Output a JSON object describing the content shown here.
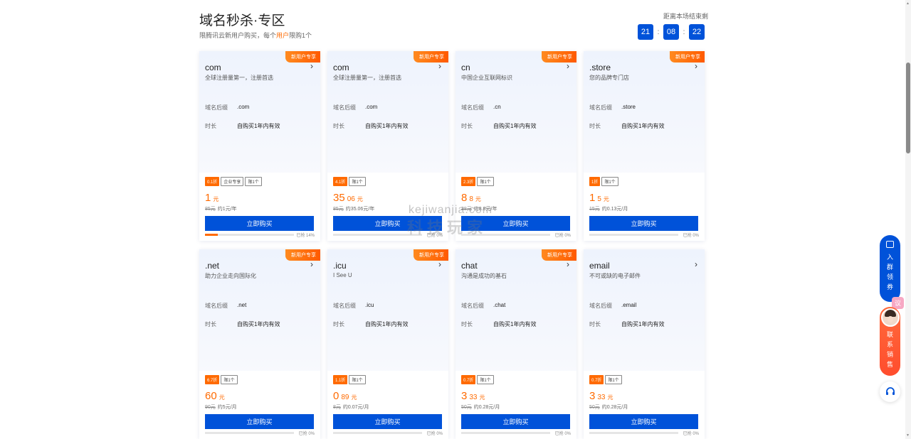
{
  "header": {
    "title": "域名秒杀·专区",
    "subtitle_prefix": "限腾讯云新用户购买，每个",
    "subtitle_highlight": "用户",
    "subtitle_suffix": "限购1个"
  },
  "countdown": {
    "label": "距离本场结束剩",
    "hours": "21",
    "minutes": "08",
    "seconds": "22",
    "sep": ":"
  },
  "labels": {
    "suffix_key": "域名后缀",
    "duration_key": "时长",
    "buy": "立即购买",
    "unit": "元",
    "limit": "限1个",
    "enterprise": "企业专享"
  },
  "cards": [
    {
      "badge": "新用户专享",
      "name": "com",
      "desc": "全球注册量第一，注册首选",
      "suffix": ".com",
      "duration": "自购买1年内有效",
      "discount": "0.1折",
      "enterprise": true,
      "price_int": "1",
      "price_dec": "",
      "orig": "85元",
      "per": "约1元/年",
      "sold": "已抢 14%",
      "sold_pct": 14
    },
    {
      "badge": "新用户专享",
      "name": "com",
      "desc": "全球注册量第一，注册首选",
      "suffix": ".com",
      "duration": "自购买1年内有效",
      "discount": "4.1折",
      "enterprise": false,
      "price_int": "35",
      "price_dec": "06",
      "orig": "85元",
      "per": "约35.06元/年",
      "sold": "已抢 0%",
      "sold_pct": 0
    },
    {
      "badge": "新用户专享",
      "name": "cn",
      "desc": "中国企业互联网标识",
      "suffix": ".cn",
      "duration": "自购买1年内有效",
      "discount": "2.3折",
      "enterprise": false,
      "price_int": "8",
      "price_dec": "8",
      "orig": "38元",
      "per": "约8.8元/年",
      "sold": "已抢 0%",
      "sold_pct": 0
    },
    {
      "badge": "新用户专享",
      "name": ".store",
      "desc": "您的品牌专门店",
      "suffix": ".store",
      "duration": "自购买1年内有效",
      "discount": "1折",
      "enterprise": false,
      "price_int": "1",
      "price_dec": "5",
      "orig": "15元",
      "per": "约0.13元/月",
      "sold": "已抢 0%",
      "sold_pct": 0
    },
    {
      "badge": "新用户专享",
      "name": ".net",
      "desc": "助力企业走向国际化",
      "suffix": ".net",
      "duration": "自购买1年内有效",
      "discount": "6.7折",
      "enterprise": false,
      "price_int": "60",
      "price_dec": "",
      "orig": "90元",
      "per": "约5元/月",
      "sold": "已抢 0%",
      "sold_pct": 0
    },
    {
      "badge": "新用户专享",
      "name": ".icu",
      "desc": "I See U",
      "suffix": ".icu",
      "duration": "自购买1年内有效",
      "discount": "1.1折",
      "enterprise": false,
      "price_int": "0",
      "price_dec": "89",
      "orig": "8元",
      "per": "约0.07元/月",
      "sold": "已抢 0%",
      "sold_pct": 0
    },
    {
      "badge": "新用户专享",
      "name": "chat",
      "desc": "沟通是成功的基石",
      "suffix": ".chat",
      "duration": "自购买1年内有效",
      "discount": "0.7折",
      "enterprise": false,
      "price_int": "3",
      "price_dec": "33",
      "orig": "50元",
      "per": "约0.28元/月",
      "sold": "已抢 0%",
      "sold_pct": 0
    },
    {
      "badge": "",
      "name": "email",
      "desc": "不可或缺的电子邮件",
      "suffix": ".email",
      "duration": "自购买1年内有效",
      "discount": "0.7折",
      "enterprise": false,
      "price_int": "3",
      "price_dec": "33",
      "orig": "50元",
      "per": "约0.28元/月",
      "sold": "已抢 0%",
      "sold_pct": 0
    }
  ],
  "watermark": {
    "top": "kejiwanjia.com",
    "bottom": "科技玩家"
  },
  "float": {
    "join_group": [
      "入",
      "群",
      "领",
      "券"
    ],
    "contact_sales": [
      "联",
      "系",
      "销",
      "售"
    ],
    "pink_badge": "议"
  }
}
